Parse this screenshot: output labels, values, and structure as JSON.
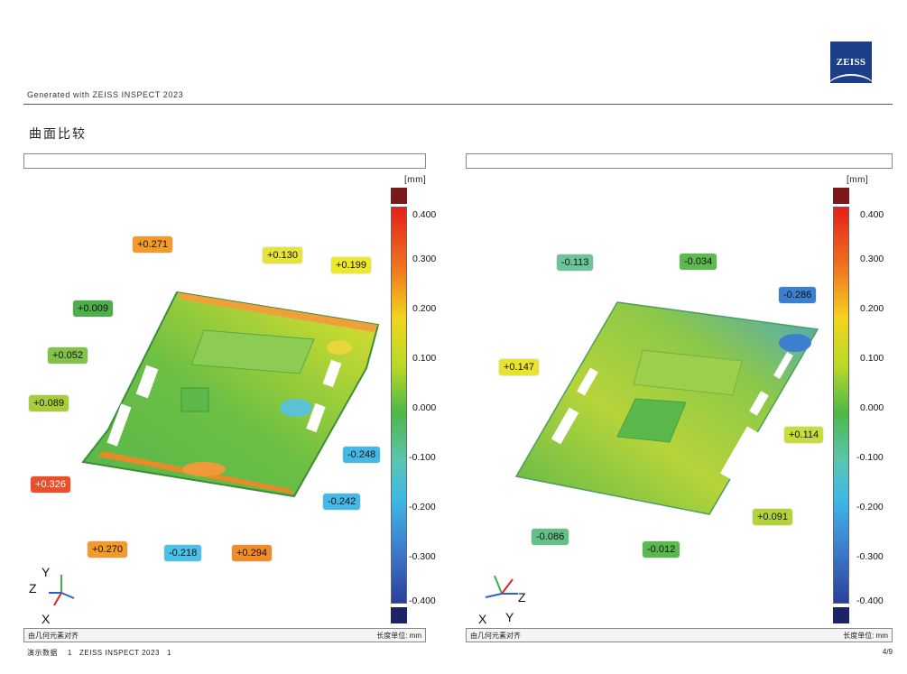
{
  "header": {
    "generated": "Generated with ZEISS INSPECT 2023",
    "logo_text": "ZEISS",
    "section_title": "曲面比较"
  },
  "colors": {
    "logo_blue": "#1c3f8a",
    "scale_top": "#7a1a1a",
    "scale_bottom": "#1e2266"
  },
  "scale": {
    "unit": "[mm]",
    "ticks": [
      "0.400",
      "0.300",
      "0.200",
      "0.100",
      "0.000",
      "-0.100",
      "-0.200",
      "-0.300",
      "-0.400"
    ]
  },
  "left_panel": {
    "footer_left": "由几何元素对齐",
    "footer_right": "长度单位: mm",
    "axes": {
      "y": "Y",
      "z": "Z",
      "x": "X"
    },
    "callouts": [
      {
        "text": "+0.271",
        "color": "#f39a2c"
      },
      {
        "text": "+0.130",
        "color": "#e6e43a"
      },
      {
        "text": "+0.199",
        "color": "#eeea2a"
      },
      {
        "text": "+0.009",
        "color": "#4dae4a"
      },
      {
        "text": "+0.052",
        "color": "#82c247"
      },
      {
        "text": "+0.089",
        "color": "#a9cc3d"
      },
      {
        "text": "-0.248",
        "color": "#44b9e8"
      },
      {
        "text": "-0.242",
        "color": "#44b9e8"
      },
      {
        "text": "+0.326",
        "color": "#e8502a"
      },
      {
        "text": "+0.270",
        "color": "#f39a2c"
      },
      {
        "text": "-0.218",
        "color": "#4cc0e6"
      },
      {
        "text": "+0.294",
        "color": "#f08a2a"
      }
    ]
  },
  "right_panel": {
    "footer_left": "由几何元素对齐",
    "footer_right": "长度单位: mm",
    "axes": {
      "z": "Z",
      "x": "X",
      "y": "Y"
    },
    "callouts": [
      {
        "text": "-0.113",
        "color": "#6dc39c"
      },
      {
        "text": "-0.034",
        "color": "#5dba4f"
      },
      {
        "text": "-0.286",
        "color": "#3d7fcf"
      },
      {
        "text": "+0.147",
        "color": "#e7e431"
      },
      {
        "text": "+0.114",
        "color": "#c8dc3a"
      },
      {
        "text": "+0.091",
        "color": "#b2d33c"
      },
      {
        "text": "-0.086",
        "color": "#64c087"
      },
      {
        "text": "-0.012",
        "color": "#5ab84f"
      }
    ]
  },
  "footer": {
    "left": "演示数据    1   ZEISS INSPECT 2023   1",
    "right": "4/9"
  }
}
